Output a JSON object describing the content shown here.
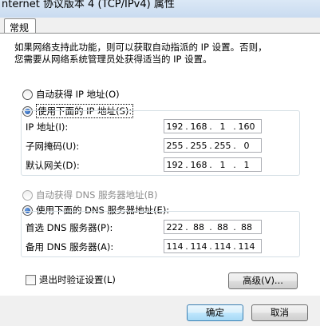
{
  "window": {
    "title": "nternet 协议版本 4 (TCP/IPv4) 属性"
  },
  "tabs": {
    "general": "常规"
  },
  "description": {
    "line1": "如果网络支持此功能，则可以获取自动指派的 IP 设置。否则，",
    "line2": "您需要从网络系统管理员处获得适当的 IP 设置。"
  },
  "ip_mode": {
    "auto_label": "自动获得 IP 地址(O)",
    "manual_label": "使用下面的 IP 地址(S):",
    "selected": "manual"
  },
  "ip_fields": {
    "ip_label": "IP 地址(I):",
    "mask_label": "子网掩码(U):",
    "gateway_label": "默认网关(D):",
    "ip": [
      "192",
      "168",
      "1",
      "160"
    ],
    "mask": [
      "255",
      "255",
      "255",
      "0"
    ],
    "gateway": [
      "192",
      "168",
      "1",
      "1"
    ]
  },
  "dns_mode": {
    "auto_label": "自动获得 DNS 服务器地址(B)",
    "manual_label": "使用下面的 DNS 服务器地址(E):",
    "selected": "manual"
  },
  "dns_fields": {
    "preferred_label": "首选 DNS 服务器(P):",
    "alternate_label": "备用 DNS 服务器(A):",
    "preferred": [
      "222",
      "88",
      "88",
      "88"
    ],
    "alternate": [
      "114",
      "114",
      "114",
      "114"
    ]
  },
  "validate": {
    "label": "退出时验证设置(L)",
    "checked": false
  },
  "buttons": {
    "advanced": "高级(V)...",
    "ok": "确定",
    "cancel": "取消"
  }
}
